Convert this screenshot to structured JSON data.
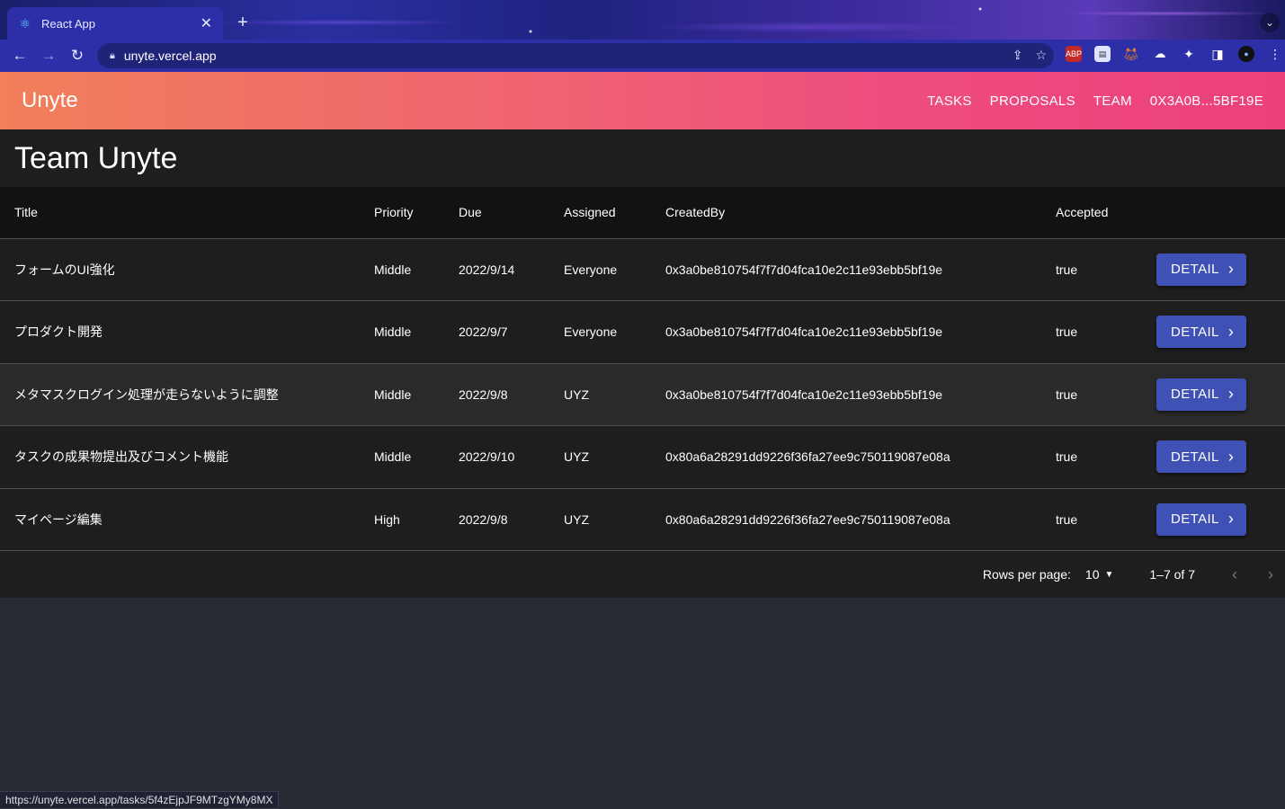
{
  "browser": {
    "tab_title": "React App",
    "tab_favicon": "react-icon",
    "url": "unyte.vercel.app",
    "status_url": "https://unyte.vercel.app/tasks/5f4zEjpJF9MTzgYMy8MX"
  },
  "appbar": {
    "brand": "Unyte",
    "nav": [
      "TASKS",
      "PROPOSALS",
      "TEAM",
      "0X3A0B...5BF19E"
    ]
  },
  "page": {
    "title": "Team Unyte"
  },
  "table": {
    "columns": [
      "Title",
      "Priority",
      "Due",
      "Assigned",
      "CreatedBy",
      "Accepted"
    ],
    "button_label": "DETAIL",
    "rows": [
      {
        "title": "フォームのUI強化",
        "priority": "Middle",
        "due": "2022/9/14",
        "assigned": "Everyone",
        "created_by": "0x3a0be810754f7f7d04fca10e2c11e93ebb5bf19e",
        "accepted": "true"
      },
      {
        "title": "プロダクト開発",
        "priority": "Middle",
        "due": "2022/9/7",
        "assigned": "Everyone",
        "created_by": "0x3a0be810754f7f7d04fca10e2c11e93ebb5bf19e",
        "accepted": "true"
      },
      {
        "title": "メタマスクログイン処理が走らないように調整",
        "priority": "Middle",
        "due": "2022/9/8",
        "assigned": "UYZ",
        "created_by": "0x3a0be810754f7f7d04fca10e2c11e93ebb5bf19e",
        "accepted": "true"
      },
      {
        "title": "タスクの成果物提出及びコメント機能",
        "priority": "Middle",
        "due": "2022/9/10",
        "assigned": "UYZ",
        "created_by": "0x80a6a28291dd9226f36fa27ee9c750119087e08a",
        "accepted": "true"
      },
      {
        "title": "マイページ編集",
        "priority": "High",
        "due": "2022/9/8",
        "assigned": "UYZ",
        "created_by": "0x80a6a28291dd9226f36fa27ee9c750119087e08a",
        "accepted": "true"
      }
    ]
  },
  "pagination": {
    "rows_per_page_label": "Rows per page:",
    "rows_per_page": "10",
    "range": "1–7 of 7"
  },
  "colors": {
    "appbar_start": "#f07f5a",
    "appbar_end": "#ec407a",
    "button": "#3f51b5",
    "surface": "#1e1e1e",
    "background": "#272a33"
  }
}
